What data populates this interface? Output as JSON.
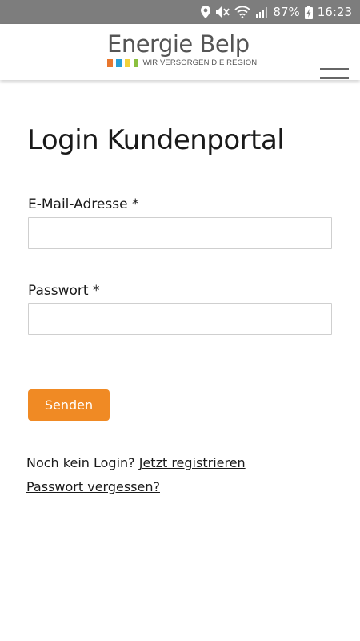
{
  "statusbar": {
    "battery_text": "87%",
    "time": "16:23",
    "icons": [
      "location-icon",
      "mute-icon",
      "wifi-icon",
      "signal-icon",
      "battery-charging-icon"
    ]
  },
  "header": {
    "logo_title": "Energie Belp",
    "logo_tagline": "WIR VERSORGEN DIE REGION!",
    "logo_colors": [
      "#e8772e",
      "#2a9fd6",
      "#f2d13a",
      "#8bc03f"
    ],
    "menu_icon": "hamburger-menu-icon"
  },
  "main": {
    "title": "Login Kundenportal",
    "email_label": "E-Mail-Adresse *",
    "email_value": "",
    "email_placeholder": "",
    "password_label": "Passwort *",
    "password_value": "",
    "password_placeholder": "",
    "submit_label": "Senden",
    "no_login_text": "Noch kein Login? ",
    "register_link": "Jetzt registrieren",
    "forgot_link": "Passwort vergessen?"
  },
  "colors": {
    "accent": "#f08a24",
    "statusbar": "#7d7d7d"
  }
}
